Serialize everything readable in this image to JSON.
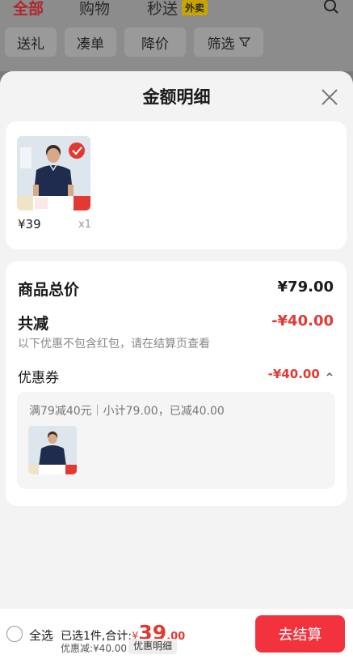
{
  "top_nav": {
    "tabs": [
      {
        "label": "全部",
        "active": true
      },
      {
        "label": "购物",
        "active": false
      },
      {
        "label": "秒送",
        "active": false
      }
    ],
    "waimai_badge": "外卖",
    "search_icon": "search-icon"
  },
  "filter_chips": [
    "送礼",
    "凑单",
    "降价",
    "筛选"
  ],
  "filter_icon": "filter-icon",
  "sheet": {
    "title": "金额明细",
    "close_icon": "close-icon"
  },
  "item_card": {
    "price": "¥39",
    "quantity": "x1"
  },
  "summary": {
    "total_label": "商品总价",
    "total_value": "¥79.00",
    "reduce_label": "共减",
    "reduce_value": "-¥40.00",
    "hint": "以下优惠不包含红包，请在结算页查看",
    "coupon_label": "优惠券",
    "coupon_value": "-¥40.00",
    "coupon_rule": "满79减40元｜小计79.00，已减40.00"
  },
  "bottom_bar": {
    "select_all": "全选",
    "selected_text": "已选1件,合计:",
    "total_currency": "¥",
    "total_int": "39",
    "total_dec": ".00",
    "discount_text": "优惠减:¥40.00",
    "detail_button": "优惠明细",
    "checkout_button": "去结算"
  },
  "colors": {
    "accent_red": "#e23a33",
    "checkout_red": "#f2323d"
  }
}
